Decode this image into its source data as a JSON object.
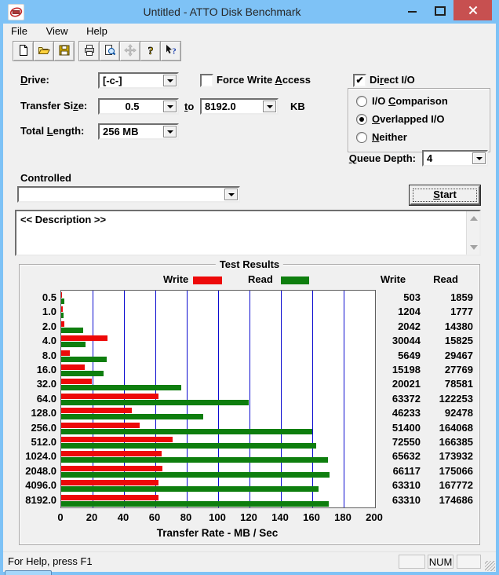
{
  "window": {
    "title": "Untitled - ATTO Disk Benchmark"
  },
  "menu": {
    "items": [
      "File",
      "View",
      "Help"
    ]
  },
  "toolbar": {
    "buttons": [
      "new-document",
      "open-file",
      "save",
      "print",
      "print-preview",
      "pan-move",
      "help",
      "context-help"
    ]
  },
  "controls": {
    "drive": {
      "label": {
        "text": "Drive:",
        "u": 0
      },
      "value": "[-c-]"
    },
    "force_write_access": {
      "label": {
        "text": "Force Write Access",
        "u": 12
      },
      "checked": false
    },
    "direct_io": {
      "label": {
        "text": "Direct I/O",
        "u": 2
      },
      "checked": true
    },
    "transfer_size": {
      "label": {
        "text": "Transfer Size:",
        "u": 11
      },
      "from": "0.5",
      "to_label": {
        "text": "to",
        "u": 0
      },
      "to": "8192.0",
      "unit": "KB"
    },
    "total_length": {
      "label": {
        "text": "Total Length:",
        "u": 6
      },
      "value": "256 MB"
    },
    "io_mode": {
      "options": [
        {
          "label": {
            "text": "I/O Comparison",
            "u": 4
          },
          "selected": false
        },
        {
          "label": {
            "text": "Overlapped I/O",
            "u": 0
          },
          "selected": true
        },
        {
          "label": {
            "text": "Neither",
            "u": 0
          },
          "selected": false
        }
      ]
    },
    "queue_depth": {
      "label": {
        "text": "Queue Depth:",
        "u": 0
      },
      "value": "4"
    },
    "controlled": {
      "label": "Controlled",
      "value": ""
    },
    "start_button": {
      "label": {
        "text": "Start",
        "u": 0
      }
    },
    "description": {
      "text": "<< Description >>"
    }
  },
  "results": {
    "group_title": "Test Results",
    "legend": {
      "write": "Write",
      "read": "Read"
    },
    "columns": {
      "write": "Write",
      "read": "Read"
    }
  },
  "chart_data": {
    "type": "bar",
    "orientation": "horizontal",
    "title": "Test Results",
    "categories": [
      "0.5",
      "1.0",
      "2.0",
      "4.0",
      "8.0",
      "16.0",
      "32.0",
      "64.0",
      "128.0",
      "256.0",
      "512.0",
      "1024.0",
      "2048.0",
      "4096.0",
      "8192.0"
    ],
    "series": [
      {
        "name": "Write",
        "color": "#ed0909",
        "values": [
          503,
          1204,
          2042,
          30044,
          5649,
          15198,
          20021,
          63372,
          46233,
          51400,
          72550,
          65632,
          66117,
          63310,
          63310
        ]
      },
      {
        "name": "Read",
        "color": "#0e7e0e",
        "values": [
          1859,
          1777,
          14380,
          15825,
          29467,
          27769,
          78581,
          122253,
          92478,
          164068,
          166385,
          173932,
          175066,
          167772,
          174686
        ]
      }
    ],
    "value_scale_note": "table values plotted as MB/Sec (value/1024)",
    "xlabel": "Transfer Rate - MB / Sec",
    "xticks": [
      0,
      20,
      40,
      60,
      80,
      100,
      120,
      140,
      160,
      180,
      200
    ],
    "xlim": [
      0,
      200
    ],
    "grid": "vertical",
    "gridline_color": "#0b0bd0"
  },
  "status_bar": {
    "text": "For Help, press F1",
    "num": "NUM"
  },
  "colors": {
    "titlebar": "#7ec2f6",
    "close_button": "#c75050",
    "client": "#f0f0f0"
  }
}
